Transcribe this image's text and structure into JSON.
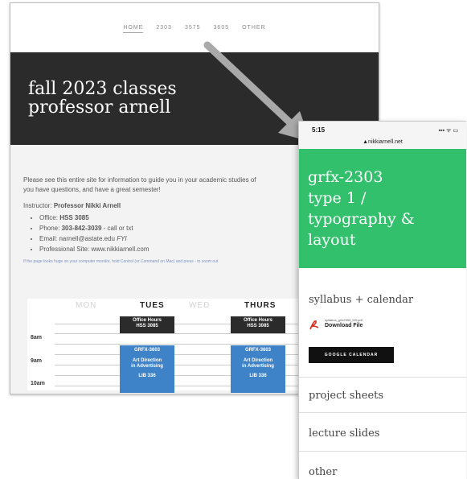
{
  "desktop": {
    "nav": [
      "HOME",
      "2303",
      "3575",
      "3605",
      "OTHER"
    ],
    "banner_title_line1": "fall 2023 classes",
    "banner_title_line2": "professor arnell",
    "intro_line1": "Please see this entire site for information to guide you in your academic studies of",
    "intro_line2": "you have questions, and have a great semester!",
    "instructor_label": "Instructor:",
    "instructor_name": "Professor Nikki Arnell",
    "office_label": "Office:",
    "office_value": "HSS 3085",
    "phone_label": "Phone:",
    "phone_value": "303-842-3039",
    "phone_note": " - call or txt",
    "email_label": "Email:",
    "email_value": "narnell@astate.edu",
    "email_note": "FYI",
    "site_label": "Professional Site:",
    "site_value": "www.nikkiarnell.com",
    "footnote": "If the page looks huge on your computer monitor, hold Control (or Command on Mac) and press - to zoom out"
  },
  "schedule": {
    "days": [
      "MON",
      "TUES",
      "WED",
      "THURS"
    ],
    "times": [
      "8am",
      "9am",
      "10am"
    ],
    "office_block_line1": "Office Hours",
    "office_block_line2": "HSS 3085",
    "course_block_code": "GRFX-3603",
    "course_block_line1": "Art Direction",
    "course_block_line2": "in Advertising",
    "course_block_room": "LIB 336"
  },
  "phone": {
    "status_time": "5:15",
    "status_icons": "▪▪▪ ᯤ ▭",
    "url": "▲nikkiarnell.net",
    "hero_line1": "grfx-2303",
    "hero_line2": "type 1 /",
    "hero_line3": "typography &",
    "hero_line4": "layout",
    "menu": [
      "syllabus + calendar",
      "project sheets",
      "lecture slides",
      "other"
    ],
    "file_name": "syllabus_grfx2303_f23.pdf",
    "file_action": "Download File",
    "calendar_button": "GOOGLE CALENDAR"
  },
  "colors": {
    "dark_banner": "#2b2b2b",
    "course_blue": "#3e83c8",
    "mobile_green": "#33c06c",
    "pdf_red": "#d93025"
  }
}
